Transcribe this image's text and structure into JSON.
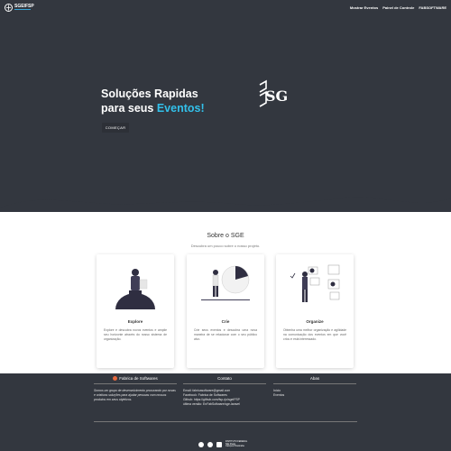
{
  "navbar": {
    "brand": "SGEIFSP",
    "links": [
      "Mostrar Eventos",
      "Painel de Controle",
      "FABSOFTWARE"
    ]
  },
  "hero": {
    "title_line1": "Soluções Rapidas",
    "title_line2_prefix": "para seus ",
    "title_line2_accent": "Eventos!",
    "button": "COMEÇAR",
    "logo_text": "SGE"
  },
  "about": {
    "title": "Sobre o SGE",
    "subtitle": "Descubra um pouco sobre o nosso projeto.",
    "cards": [
      {
        "title": "Explore",
        "text": "Explore e descubra novos eventos e amplie seu horizonte através do nosso sistema de organização."
      },
      {
        "title": "Crie",
        "text": "Crie seus eventos e descubra uma nova maneira de se relacionar com o seu público alvo."
      },
      {
        "title": "Organize",
        "text": "Obtenha uma melhor organização e agilidade na comunicação dos eventos em que você criou e está interessado."
      }
    ]
  },
  "footer": {
    "col1": {
      "heading": "Fabrica de Softwares",
      "text": "Somos um grupo de desenvolvimento procurando por novas e criativas soluções para ajudar pessoas com nossos produtos em seus objetivos."
    },
    "col2": {
      "heading": "Contato",
      "lines": [
        "Email: fabricasoftware@gmail.com",
        "Facebook: Fabrica de Softwares",
        "Github: https://github.com/fsp-rjo/sgeIFSP",
        "última versão: EnFabSoftware/sge-laravel"
      ]
    },
    "col3": {
      "heading": "Abas",
      "lines": [
        "Início",
        "Eventos"
      ]
    },
    "institution_line1": "INSTITUTO FEDERAL",
    "institution_line2": "São Paulo",
    "institution_line3": "Campus Piracicaba"
  },
  "colors": {
    "dark": "#33373f",
    "accent": "#32c0ea",
    "footer_icon": "#e5683e"
  }
}
